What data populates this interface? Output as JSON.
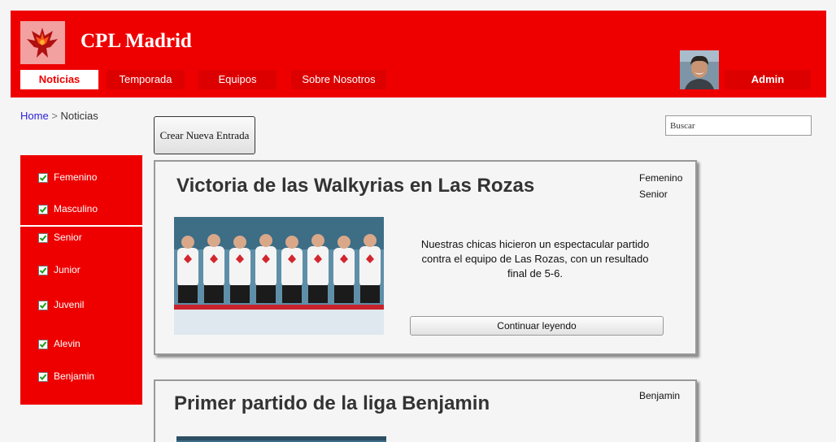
{
  "header": {
    "site_title": "CPL Madrid",
    "logo_icon": "phoenix-logo-icon",
    "nav": [
      {
        "label": "Noticias",
        "active": true
      },
      {
        "label": "Temporada",
        "active": false
      },
      {
        "label": "Equipos",
        "active": false
      },
      {
        "label": "Sobre Nosotros",
        "active": false
      }
    ],
    "user_label": "Admin",
    "avatar_icon": "user-avatar"
  },
  "breadcrumb": {
    "home": "Home",
    "separator": ">",
    "current": "Noticias"
  },
  "toolbar": {
    "create_label": "Crear Nueva Entrada"
  },
  "search": {
    "value": "Buscar"
  },
  "filters": [
    {
      "label": "Femenino",
      "checked": true
    },
    {
      "label": "Masculino",
      "checked": true
    },
    {
      "label": "Senior",
      "checked": true
    },
    {
      "label": "Junior",
      "checked": true
    },
    {
      "label": "Juvenil",
      "checked": true
    },
    {
      "label": "Alevin",
      "checked": true
    },
    {
      "label": "Benjamin",
      "checked": true
    }
  ],
  "posts": [
    {
      "title": "Victoria de las Walkyrias en Las Rozas",
      "tags": [
        "Femenino",
        "Senior"
      ],
      "excerpt": "Nuestras chicas hicieron un espectacular partido contra el equipo de Las Rozas, con un resultado final de 5-6.",
      "read_more": "Continuar leyendo"
    },
    {
      "title": "Primer partido de la liga Benjamin",
      "tags": [
        "Benjamin"
      ]
    }
  ],
  "colors": {
    "brand_red": "#ee0000",
    "link_blue": "#2a1fd6"
  }
}
